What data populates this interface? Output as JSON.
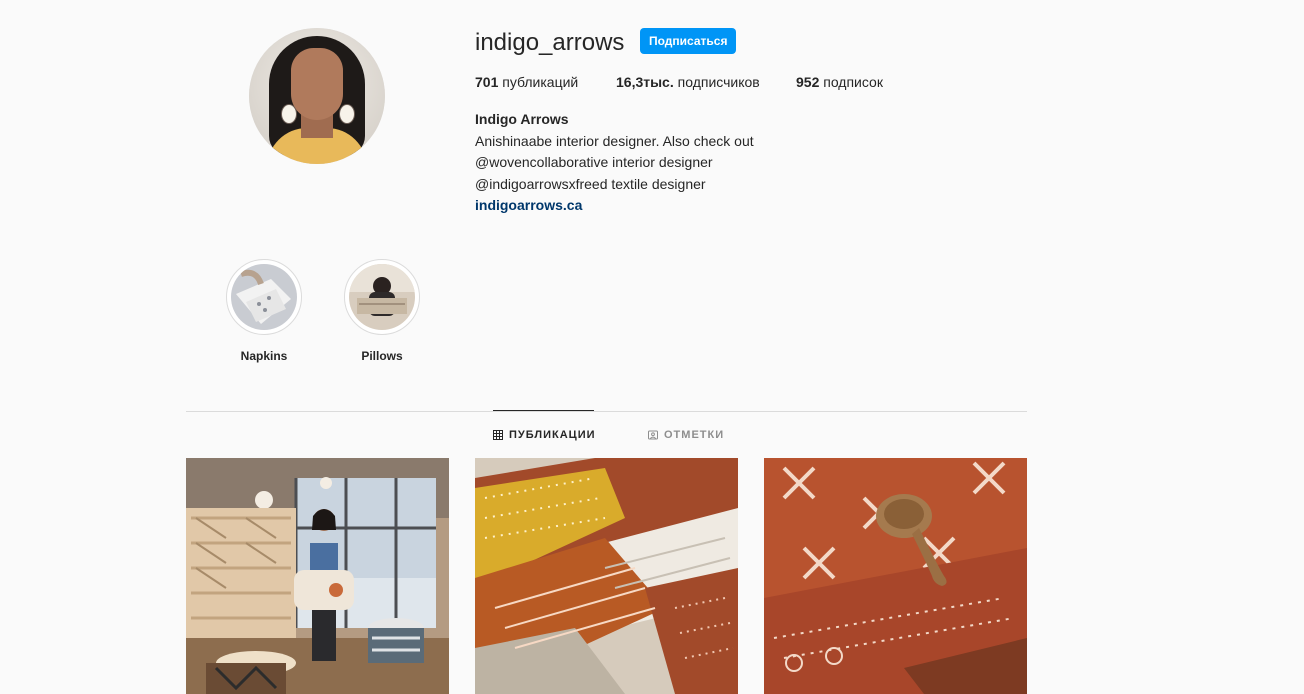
{
  "profile": {
    "username": "indigo_arrows",
    "follow_label": "Подписаться",
    "stats": {
      "posts_count": "701",
      "posts_label": "публикаций",
      "followers_count": "16,3тыс.",
      "followers_label": "подписчиков",
      "following_count": "952",
      "following_label": "подписок"
    },
    "bio": {
      "name": "Indigo Arrows",
      "line1": "Anishinaabe interior designer. Also check out",
      "line2": "@wovencollaborative interior designer",
      "line3": "@indigoarrowsxfreed textile designer",
      "website": "indigoarrows.ca"
    }
  },
  "highlights": [
    {
      "label": "Napkins"
    },
    {
      "label": "Pillows"
    }
  ],
  "tabs": [
    {
      "label": "ПУБЛИКАЦИИ",
      "icon": "grid-icon",
      "active": true
    },
    {
      "label": "ОТМЕТКИ",
      "icon": "tagged-icon",
      "active": false
    }
  ],
  "colors": {
    "accent": "#0095f6",
    "link": "#00376b",
    "background": "#fafafa"
  }
}
